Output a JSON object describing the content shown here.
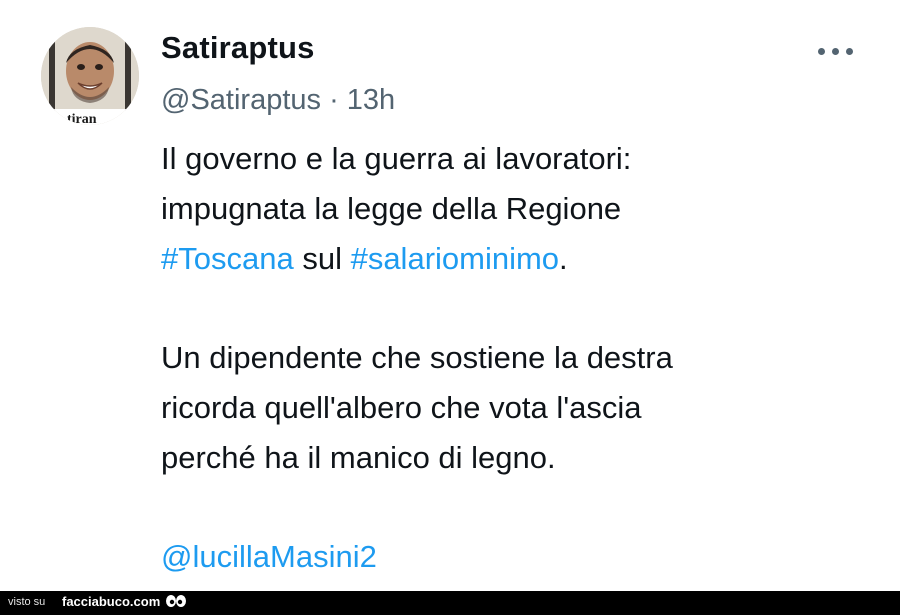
{
  "tweet": {
    "display_name": "Satiraptus",
    "handle": "@Satiraptus",
    "separator": " · ",
    "time": "13h",
    "avatar_text": "tiran",
    "body": {
      "line1": "Il governo e la guerra ai lavoratori:",
      "line2": "impugnata la legge della Regione",
      "hashtag1": "#Toscana",
      "between": " sul ",
      "hashtag2": "#salariominimo",
      "end_punct": ".",
      "line4": "Un dipendente che sostiene la destra",
      "line5": "ricorda quell'albero che vota l'ascia",
      "line6": "perché ha il manico di legno.",
      "mention": "@lucillaMasini2"
    }
  },
  "footer": {
    "prefix": "visto su",
    "site": "facciabuco.com"
  },
  "colors": {
    "text": "#0f1419",
    "secondary": "#536471",
    "link": "#1d9bf0",
    "footer_bg": "#000000"
  },
  "icons": {
    "more": "more-horizontal-icon",
    "eyes": "eyes-icon"
  }
}
